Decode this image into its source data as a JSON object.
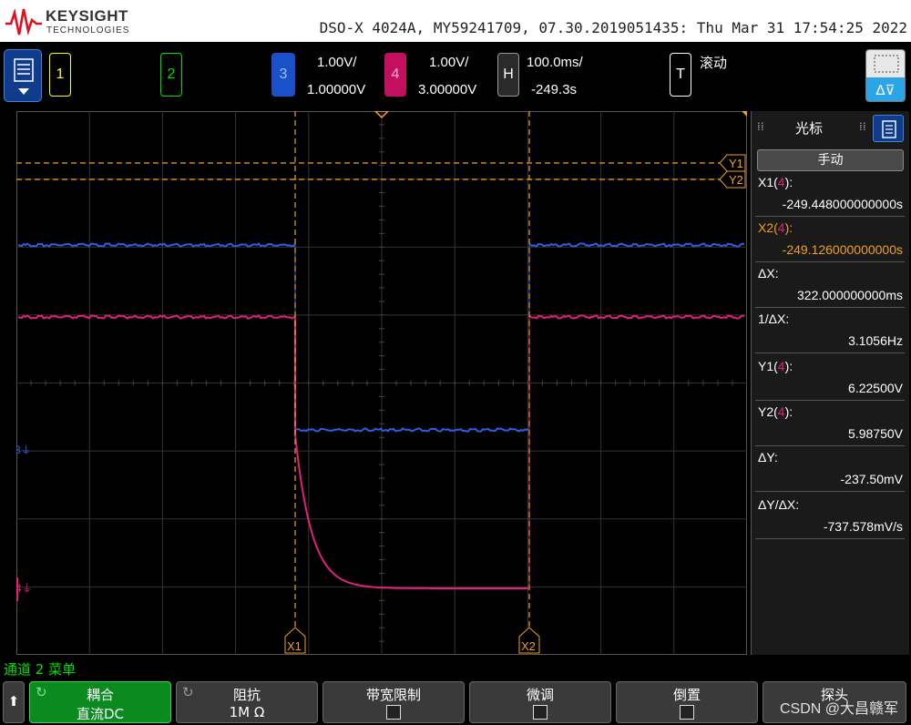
{
  "header": {
    "brand": "KEYSIGHT",
    "brand_sub": "TECHNOLOGIES",
    "status_line": "DSO-X 4024A, MY59241709, 07.30.2019051435: Thu Mar 31 17:54:25 2022"
  },
  "channels": {
    "ch1_label": "1",
    "ch2_label": "2",
    "ch3_label": "3",
    "ch3_scale": "1.00V/",
    "ch3_offset": "1.00000V",
    "ch4_label": "4",
    "ch4_scale": "1.00V/",
    "ch4_offset": "3.00000V"
  },
  "horizontal": {
    "label": "H",
    "scale": "100.0ms/",
    "position": "-249.3s"
  },
  "trigger": {
    "label": "T",
    "mode": "滚动"
  },
  "screen_labels": {
    "y1": "Y1",
    "y2": "Y2",
    "x1": "X1",
    "x2": "X2",
    "ch3_marker": "3",
    "ch4_marker": "4"
  },
  "cursors_panel": {
    "title": "光标",
    "mode": "手动",
    "x1_label": "X1(4):",
    "x1_value": "-249.448000000000s",
    "x2_label": "X2(4):",
    "x2_value": "-249.126000000000s",
    "dx_label": "ΔX:",
    "dx_value": "322.000000000ms",
    "inv_dx_label": "1/ΔX:",
    "inv_dx_value": "3.1056Hz",
    "y1_label": "Y1(4):",
    "y1_value": "6.22500V",
    "y2_label": "Y2(4):",
    "y2_value": "5.98750V",
    "dy_label": "ΔY:",
    "dy_value": "-237.50mV",
    "dydx_label": "ΔY/ΔX:",
    "dydx_value": "-737.578mV/s"
  },
  "bottom": {
    "channel_menu": "通道 2 菜单",
    "coupling_label": "耦合",
    "coupling_value": "直流DC",
    "impedance_label": "阻抗",
    "impedance_value": "1M Ω",
    "bw_limit_label": "带宽限制",
    "fine_label": "微调",
    "invert_label": "倒置",
    "probe_label": "探头"
  },
  "watermark": "CSDN @大昌赣军",
  "colors": {
    "ch1": "#ffff00",
    "ch2": "#00e000",
    "ch3": "#2f5fe0",
    "ch4": "#e0207a",
    "cursor": "#f0a020",
    "active_softkey": "#0b8a20"
  }
}
